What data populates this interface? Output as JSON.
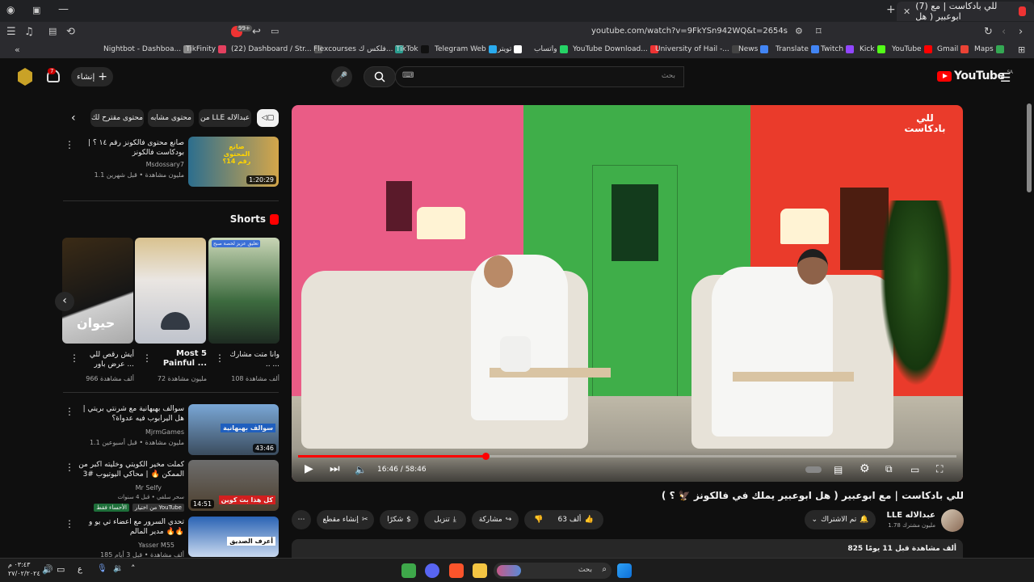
{
  "browser": {
    "tab_title": "(7) للي بادكاست | مع ابوعبير ( هل",
    "tab_badge": "7",
    "url": "youtube.com/watch?v=9FkYSn942WQ&t=2654s",
    "ext_badge": "99+",
    "bookmarks": [
      {
        "label": "Nightbot - Dashboa...",
        "color": "#888"
      },
      {
        "label": "TikFinity",
        "color": "#e4405f"
      },
      {
        "label": "(22) Dashboard / Str...",
        "color": "#555"
      },
      {
        "label": "Flexcourses فلكس ك...",
        "color": "#2a9d8f"
      },
      {
        "label": "TikTok",
        "color": "#111"
      },
      {
        "label": "Telegram Web",
        "color": "#2aabee"
      },
      {
        "label": "تويتر",
        "color": "#fff"
      },
      {
        "label": "واتساب",
        "color": "#25d366"
      },
      {
        "label": "YouTube Download...",
        "color": "#e33"
      },
      {
        "label": "University of Hail -...",
        "color": "#444"
      },
      {
        "label": "News",
        "color": "#4285f4"
      },
      {
        "label": "Translate",
        "color": "#4285f4"
      },
      {
        "label": "Twitch",
        "color": "#9146ff"
      },
      {
        "label": "Kick",
        "color": "#53fc18"
      },
      {
        "label": "YouTube",
        "color": "#f00"
      },
      {
        "label": "Gmail",
        "color": "#ea4335"
      },
      {
        "label": "Maps",
        "color": "#34a853"
      }
    ]
  },
  "header": {
    "logo": "YouTube",
    "country": "SA",
    "search_placeholder": "بحث",
    "create_label": "إنشاء",
    "notifications": "7"
  },
  "chips": [
    "من LLE عبدالاله",
    "محتوى مشابه",
    "محتوى مقترح لك"
  ],
  "related_top": {
    "title": "صانع محتوى فالكونز رقم ١٤ ؟ | بودكاست فالكونز",
    "channel": "Msdossary7",
    "meta": "1.1 مليون مشاهدة • قبل شهرين",
    "duration": "1:20:29",
    "thumb_text": "صانع المحتوى رقم 14؟"
  },
  "shorts": {
    "heading": "Shorts",
    "items": [
      {
        "title": "وانا متت مشارك .. ...",
        "views": "108 ألف مشاهدة",
        "overlay": "تعليق عزيز لحصة صبح"
      },
      {
        "title": "Most 5 Painful ...",
        "views": "72 مليون مشاهدة"
      },
      {
        "title": "أيش رقص للي عرض باور ...",
        "views": "966 ألف مشاهدة",
        "overlay": "حيوان"
      }
    ]
  },
  "related": [
    {
      "title": "سوالف بهبهانية مع شرنتي بريتي | هل اليرابوب فيه عدواة؟",
      "channel": "MjrmGames",
      "meta": "1.1 مليون مشاهدة • قبل أسبوعين",
      "duration": "43:46",
      "thumb_text": "سوالف بهبهانية"
    },
    {
      "title": "كملت مخير الكويتي وخليته اكبر من الممكن 🔥 | محاكي اليوتيوب #3",
      "channel": "Mr Selfy",
      "meta": "سحر سلفي • قبل 4 سنوات",
      "duration": "14:51",
      "badge": "من اختيار YouTube",
      "badge2": "الأحساء فقط",
      "thumb_text": "كل هذا بت كوين"
    },
    {
      "title": "تحدي السرور مع اعضاء تي يو و مدير المالم 🔥🔥",
      "channel": "Yasser M55",
      "meta": "185 ألف مشاهدة • قبل 3 أيام",
      "thumb_text": "أعرف الصديق"
    }
  ],
  "player": {
    "time": "16:46 / 58:46",
    "progress": 0.285,
    "logo_text": "للي بادكاست"
  },
  "video": {
    "title": "للي بادكاست | مع ابوعبير ( هل ابوعبير يملك في فالكونز 🦅 ؟ )",
    "channel": "LLE عبدالاله",
    "subs": "1.78 مليون مشترك",
    "subscribe_label": "تم الاشتراك",
    "likes": "63 ألف",
    "share_label": "مشاركة",
    "download_label": "تنزيل",
    "thanks_label": "شكرًا",
    "clip_label": "إنشاء مقطع",
    "description_meta": "825 ألف مشاهدة قبل 11 يومًا"
  },
  "taskbar": {
    "search_label": "بحث",
    "lang": "ع",
    "time": "٠٣:٤٣ م",
    "date": "٢٧/٠٢/٢٠٢٤"
  }
}
